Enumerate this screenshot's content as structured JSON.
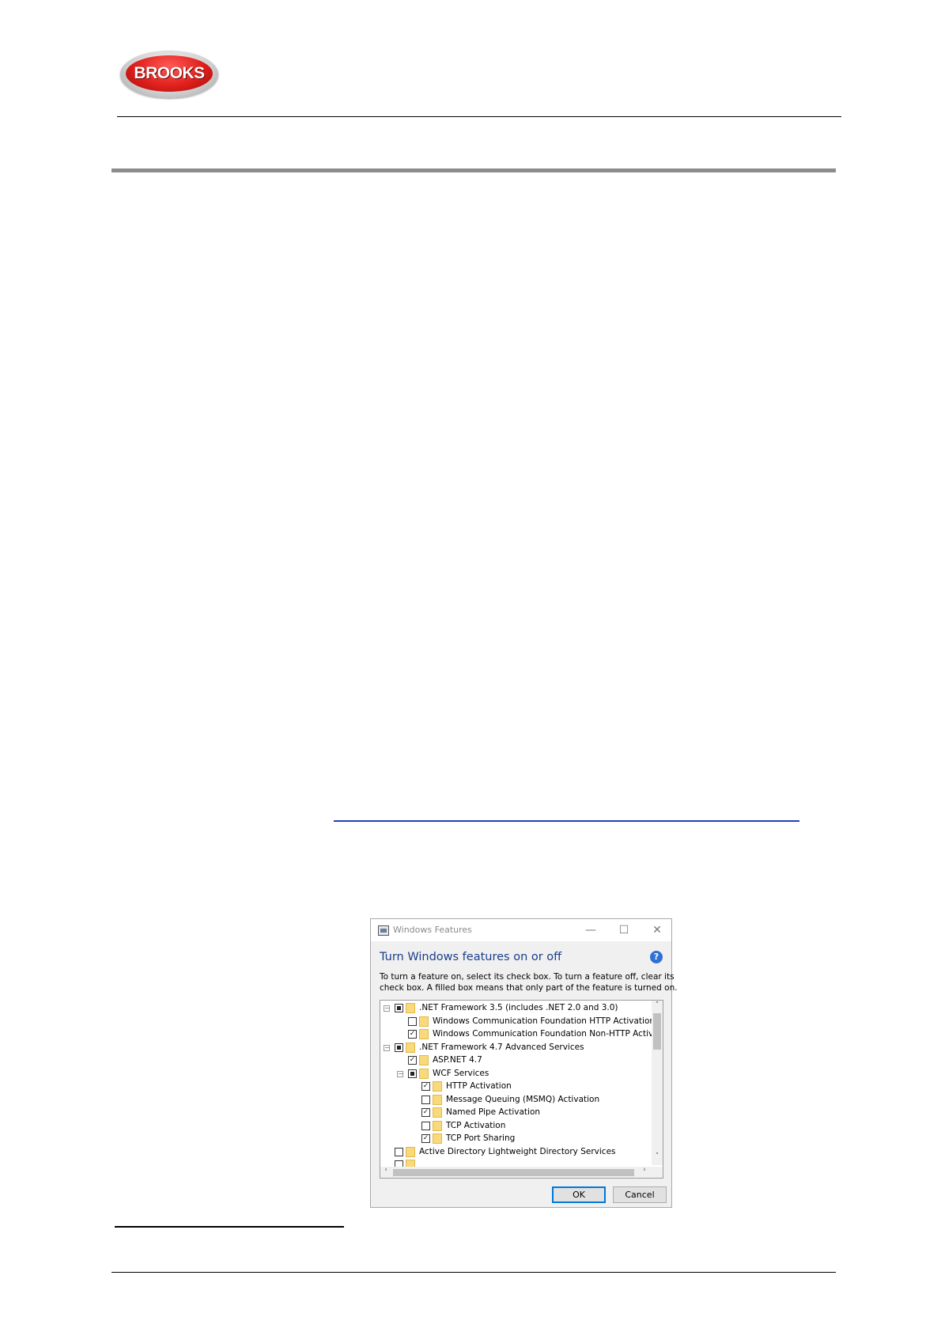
{
  "header": {
    "logo_text": "BROOKS"
  },
  "dialog": {
    "window_title": "Windows Features",
    "minimize_glyph": "—",
    "maximize_glyph": "☐",
    "close_glyph": "✕",
    "heading": "Turn Windows features on or off",
    "help_glyph": "?",
    "description_line1": "To turn a feature on, select its check box. To turn a feature off, clear its",
    "description_line2": "check box. A filled box means that only part of the feature is turned on.",
    "features": [
      {
        "label": ".NET Framework 3.5 (includes .NET 2.0 and 3.0)",
        "state": "partial",
        "level": 0,
        "expander": "⊟"
      },
      {
        "label": "Windows Communication Foundation HTTP Activation",
        "state": "unchecked",
        "level": 1,
        "expander": ""
      },
      {
        "label": "Windows Communication Foundation Non-HTTP Activa",
        "state": "checked",
        "level": 1,
        "expander": ""
      },
      {
        "label": ".NET Framework 4.7 Advanced Services",
        "state": "partial",
        "level": 0,
        "expander": "⊟"
      },
      {
        "label": "ASP.NET 4.7",
        "state": "checked",
        "level": 1,
        "expander": ""
      },
      {
        "label": "WCF Services",
        "state": "partial",
        "level": 1,
        "expander": "⊟"
      },
      {
        "label": "HTTP Activation",
        "state": "checked",
        "level": 2,
        "expander": ""
      },
      {
        "label": "Message Queuing (MSMQ) Activation",
        "state": "unchecked",
        "level": 2,
        "expander": ""
      },
      {
        "label": "Named Pipe Activation",
        "state": "checked",
        "level": 2,
        "expander": ""
      },
      {
        "label": "TCP Activation",
        "state": "unchecked",
        "level": 2,
        "expander": ""
      },
      {
        "label": "TCP Port Sharing",
        "state": "checked",
        "level": 2,
        "expander": ""
      },
      {
        "label": "Active Directory Lightweight Directory Services",
        "state": "unchecked",
        "level": 0,
        "expander": ""
      },
      {
        "label": "",
        "state": "unchecked",
        "level": 0,
        "expander": ""
      }
    ],
    "scroll_up": "˄",
    "scroll_down": "˅",
    "scroll_left": "‹",
    "scroll_right": "›",
    "ok_label": "OK",
    "cancel_label": "Cancel"
  }
}
